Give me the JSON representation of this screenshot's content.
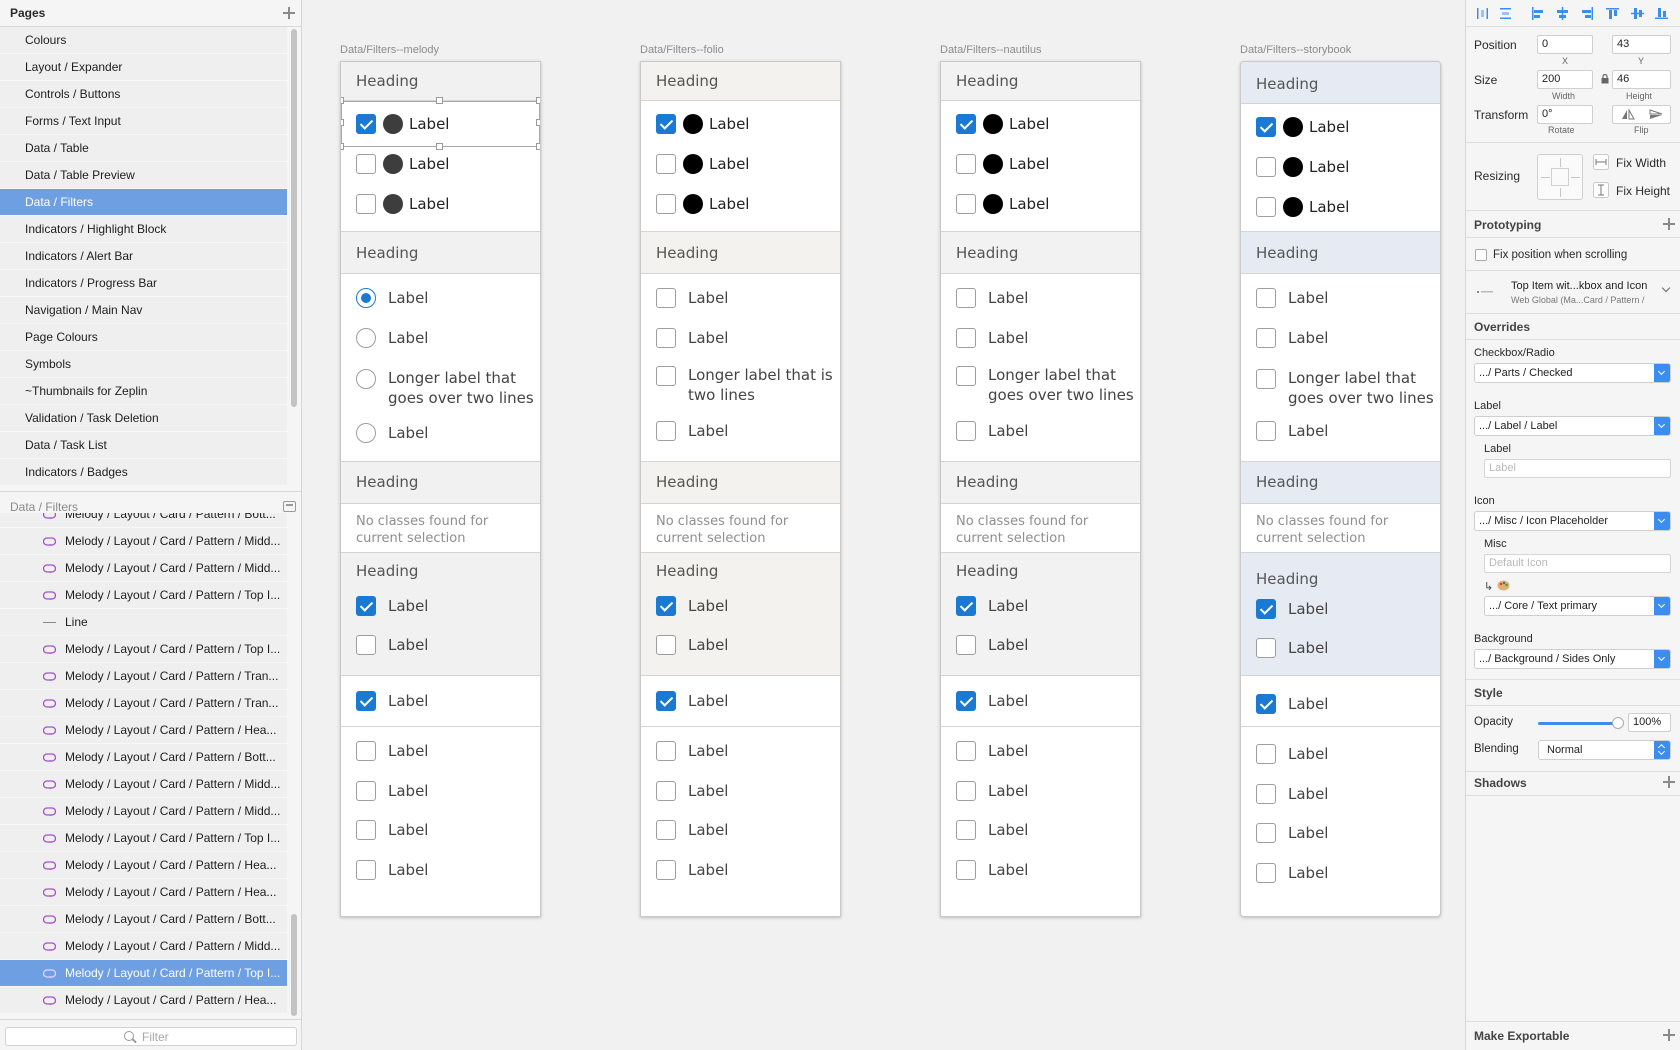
{
  "pages_panel": {
    "title": "Pages",
    "items": [
      "Colours",
      "Layout / Expander",
      "Controls / Buttons",
      "Forms / Text Input",
      "Data / Table",
      "Data / Table Preview",
      "Data / Filters",
      "Indicators / Highlight Block",
      "Indicators / Alert Bar",
      "Indicators / Progress Bar",
      "Navigation / Main Nav",
      "Page Colours",
      "Symbols",
      "~Thumbnails for Zeplin",
      "Validation / Task Deletion",
      "Data / Task List",
      "Indicators / Badges"
    ],
    "selected_index": 6
  },
  "layers_panel": {
    "title": "Data / Filters",
    "items": [
      {
        "label": "Melody / Layout / Card / Pattern / Bott...",
        "icon": "symbol-icon"
      },
      {
        "label": "Melody / Layout / Card / Pattern / Midd...",
        "icon": "symbol-icon"
      },
      {
        "label": "Melody / Layout / Card / Pattern / Midd...",
        "icon": "symbol-icon"
      },
      {
        "label": "Melody / Layout / Card / Pattern / Top I...",
        "icon": "symbol-icon"
      },
      {
        "label": "Line",
        "icon": "line-icon"
      },
      {
        "label": "Melody / Layout / Card / Pattern / Top I...",
        "icon": "symbol-icon"
      },
      {
        "label": "Melody / Layout / Card / Pattern / Tran...",
        "icon": "symbol-icon"
      },
      {
        "label": "Melody / Layout / Card / Pattern / Tran...",
        "icon": "symbol-icon"
      },
      {
        "label": "Melody / Layout / Card / Pattern / Hea...",
        "icon": "symbol-icon"
      },
      {
        "label": "Melody / Layout / Card / Pattern / Bott...",
        "icon": "symbol-icon"
      },
      {
        "label": "Melody / Layout / Card / Pattern / Midd...",
        "icon": "symbol-icon"
      },
      {
        "label": "Melody / Layout / Card / Pattern / Midd...",
        "icon": "symbol-icon"
      },
      {
        "label": "Melody / Layout / Card / Pattern / Top I...",
        "icon": "symbol-icon"
      },
      {
        "label": "Melody / Layout / Card / Pattern / Hea...",
        "icon": "symbol-icon"
      },
      {
        "label": "Melody / Layout / Card / Pattern / Hea...",
        "icon": "symbol-icon"
      },
      {
        "label": "Melody / Layout / Card / Pattern / Bott...",
        "icon": "symbol-icon"
      },
      {
        "label": "Melody / Layout / Card / Pattern / Midd...",
        "icon": "symbol-icon"
      },
      {
        "label": "Melody / Layout / Card / Pattern / Top I...",
        "icon": "symbol-icon"
      },
      {
        "label": "Melody / Layout / Card / Pattern / Hea...",
        "icon": "symbol-icon"
      }
    ],
    "selected_index": 17,
    "filter_placeholder": "Filter"
  },
  "artboards": [
    {
      "name": "Data/Filters--melody",
      "heading": "Heading",
      "label": "Label",
      "long_label": "Longer label that goes over two lines",
      "no_classes": "No classes found for current selection",
      "top_checked": [
        true,
        false,
        false
      ],
      "radio_selected": 0,
      "header_bg": "#f1f1f1",
      "dot_color": "#3d3d3d"
    },
    {
      "name": "Data/Filters--folio",
      "heading": "Heading",
      "label": "Label",
      "long_label": "Longer label that is two lines",
      "no_classes": "No classes found for current selection",
      "top_checked": [
        true,
        false,
        false
      ],
      "radio_selected": -1,
      "header_bg": "#f3f2ee",
      "dot_color": "#000000"
    },
    {
      "name": "Data/Filters--nautilus",
      "heading": "Heading",
      "label": "Label",
      "long_label": "Longer label that goes over two lines",
      "no_classes": "No classes found for current selection",
      "top_checked": [
        true,
        false,
        false
      ],
      "radio_selected": -1,
      "header_bg": "#f2f2f2",
      "dot_color": "#000000"
    },
    {
      "name": "Data/Filters--storybook",
      "heading": "Heading",
      "label": "Label",
      "long_label": "Longer label that goes over two lines",
      "no_classes": "No classes found for current selection",
      "top_checked": [
        true,
        false,
        false
      ],
      "radio_selected": -1,
      "header_bg": "#e6ebf3",
      "dot_color": "#000000"
    }
  ],
  "inspector": {
    "position_label": "Position",
    "x": "0",
    "y": "43",
    "x_caption": "X",
    "y_caption": "Y",
    "size_label": "Size",
    "width": "200",
    "height": "46",
    "width_caption": "Width",
    "height_caption": "Height",
    "transform_label": "Transform",
    "rotate": "0°",
    "rotate_caption": "Rotate",
    "flip_caption": "Flip",
    "resizing_label": "Resizing",
    "fix_width": "Fix Width",
    "fix_height": "Fix Height",
    "prototyping_title": "Prototyping",
    "fix_position": "Fix position when scrolling",
    "symbol_name": "Top Item wit...kbox and Icon",
    "symbol_path": "Web Global (Ma...Card / Pattern /",
    "overrides_title": "Overrides",
    "checkbox_radio_label": "Checkbox/Radio",
    "checkbox_radio_value": ".../ Parts / Checked",
    "label_label": "Label",
    "label_value": ".../ Label / Label",
    "label_sub_label": "Label",
    "label_sub_placeholder": "Label",
    "icon_label": "Icon",
    "icon_value": ".../ Misc / Icon Placeholder",
    "misc_label": "Misc",
    "misc_placeholder": "Default Icon",
    "core_value": ".../ Core / Text primary",
    "background_label": "Background",
    "background_value": ".../ Background / Sides Only",
    "style_title": "Style",
    "opacity_label": "Opacity",
    "opacity_value": "100%",
    "opacity": 1.0,
    "blending_label": "Blending",
    "blending_value": "Normal",
    "shadows_title": "Shadows",
    "exportable_title": "Make Exportable",
    "accent_color": "#3b8ef0"
  }
}
